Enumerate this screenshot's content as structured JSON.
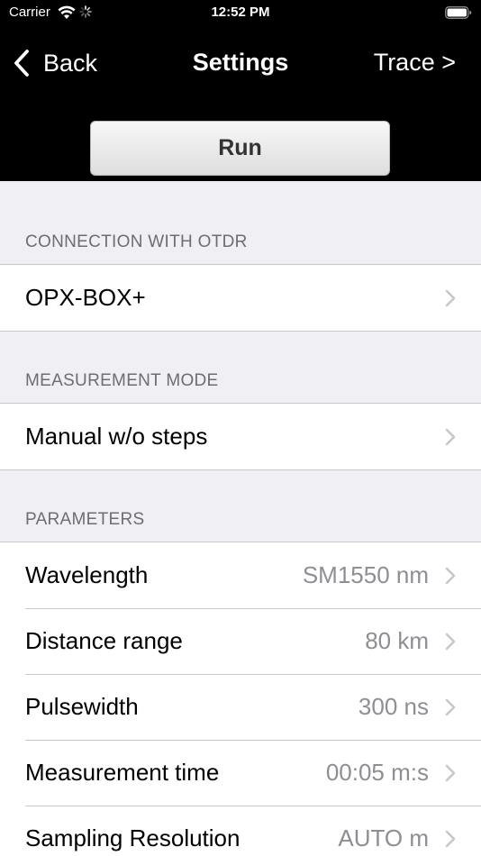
{
  "status_bar": {
    "carrier": "Carrier",
    "time": "12:52 PM",
    "wifi_icon": "wifi-icon",
    "activity_icon": "spinner-icon",
    "battery_icon": "battery-icon"
  },
  "nav": {
    "back_label": "Back",
    "title": "Settings",
    "trace_label": "Trace >"
  },
  "run_button": {
    "label": "Run"
  },
  "sections": {
    "connection": {
      "header": "CONNECTION WITH OTDR",
      "rows": [
        {
          "label": "OPX-BOX+",
          "value": ""
        }
      ]
    },
    "mode": {
      "header": "MEASUREMENT MODE",
      "rows": [
        {
          "label": "Manual w/o steps",
          "value": ""
        }
      ]
    },
    "parameters": {
      "header": "PARAMETERS",
      "rows": [
        {
          "label": "Wavelength",
          "value": "SM1550 nm"
        },
        {
          "label": "Distance range",
          "value": "80 km"
        },
        {
          "label": "Pulsewidth",
          "value": "300 ns"
        },
        {
          "label": "Measurement time",
          "value": "00:05 m:s"
        },
        {
          "label": "Sampling Resolution",
          "value": "AUTO m"
        }
      ]
    }
  },
  "colors": {
    "header_bg": "#000000",
    "page_bg": "#efeff4",
    "section_text": "#6d6d72",
    "value_text": "#8e8e93",
    "chevron": "#c7c7cc"
  }
}
